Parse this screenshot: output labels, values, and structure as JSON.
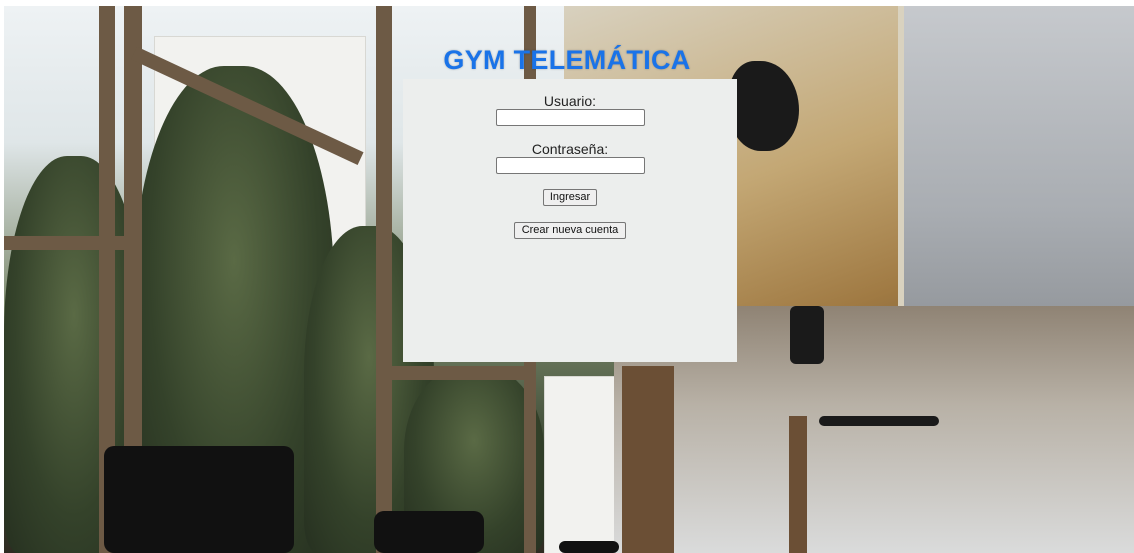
{
  "header": {
    "title": "GYM TELEMÁTICA"
  },
  "login_form": {
    "username_label": "Usuario:",
    "username_value": "",
    "password_label": "Contraseña:",
    "password_value": "",
    "submit_label": "Ingresar",
    "create_account_label": "Crear nueva cuenta"
  },
  "colors": {
    "title": "#1a73e8",
    "panel_background": "#eceeed"
  }
}
